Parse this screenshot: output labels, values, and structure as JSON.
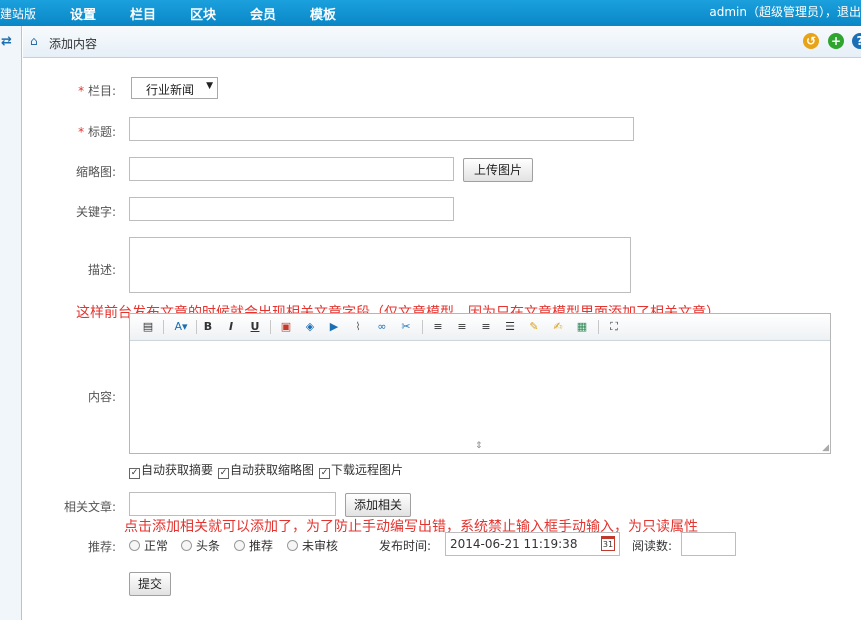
{
  "topbar": {
    "brand": "建站版",
    "nav": [
      "设置",
      "栏目",
      "区块",
      "会员",
      "模板"
    ],
    "user": "admin（超级管理员），退出"
  },
  "crumb": {
    "title": "添加内容"
  },
  "form": {
    "category_label": "栏目:",
    "category_value": "行业新闻",
    "title_label": "标题:",
    "thumb_label": "缩略图:",
    "upload_button": "上传图片",
    "keywords_label": "关键字:",
    "desc_label": "描述:",
    "content_label": "内容:",
    "options": [
      "自动获取摘要",
      "自动获取缩略图",
      "下载远程图片"
    ],
    "related_label": "相关文章:",
    "related_button": "添加相关",
    "recommend_label": "推荐:",
    "recommend_options": [
      "正常",
      "头条",
      "推荐",
      "未审核"
    ],
    "publish_label": "发布时间:",
    "publish_value": "2014-06-21 11:19:38",
    "views_label": "阅读数:",
    "submit_button": "提交"
  },
  "notes": {
    "related_note": "这样前台发布文章的时候就会出现相关文章字段（仅文章模型，因为只在文章模型里面添加了相关文章）",
    "readonly_note": "点击添加相关就可以添加了，为了防止手动编写出错，系统禁止输入框手动输入，为只读属性"
  },
  "icons": {
    "home": "home-icon",
    "refresh": "refresh-icon",
    "colors": {
      "topbar": "#0e90d2",
      "note": "#e3342f"
    }
  }
}
